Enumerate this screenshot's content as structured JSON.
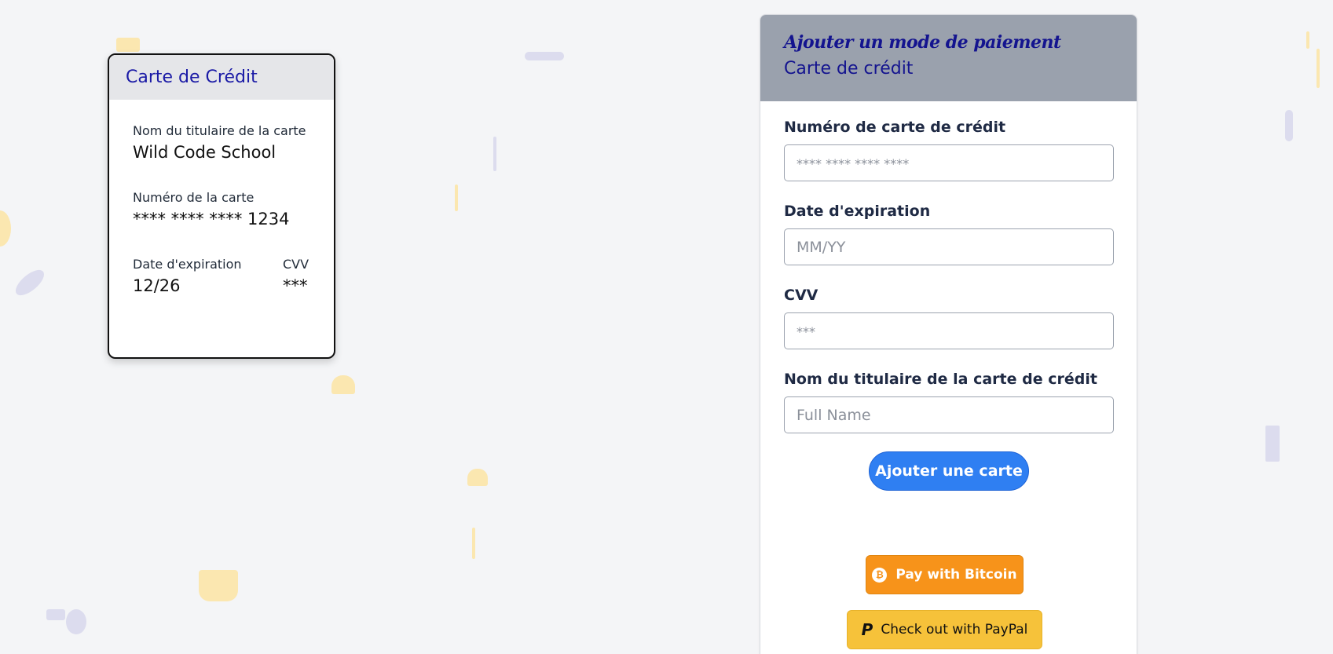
{
  "card_preview": {
    "title": "Carte de Crédit",
    "holder_label": "Nom du titulaire de la carte",
    "holder_value": "Wild Code School",
    "number_label": "Numéro de la carte",
    "number_value": "**** **** **** 1234",
    "expiry_label": "Date d'expiration",
    "expiry_value": "12/26",
    "cvv_label": "CVV",
    "cvv_value": "***"
  },
  "form": {
    "title": "Ajouter un mode de paiement",
    "subtitle": "Carte de crédit",
    "fields": {
      "card_number": {
        "label": "Numéro de carte de crédit",
        "placeholder": "**** **** **** ****"
      },
      "expiry": {
        "label": "Date d'expiration",
        "placeholder": "MM/YY"
      },
      "cvv": {
        "label": "CVV",
        "placeholder": "***"
      },
      "holder": {
        "label": "Nom du titulaire de la carte de crédit",
        "placeholder": "Full Name"
      }
    },
    "submit_label": "Ajouter une carte",
    "bitcoin_label": "Pay with Bitcoin",
    "bitcoin_icon_glyph": "₿",
    "paypal_label": "Check out with PayPal",
    "paypal_icon_glyph": "P"
  },
  "icons": {
    "bitcoin": "bitcoin-icon",
    "paypal": "paypal-icon"
  },
  "colors": {
    "background": "#f4f5f7",
    "accent_navy": "#14148f",
    "submit_blue": "#2f7ff2",
    "bitcoin_orange": "#f7931a",
    "paypal_yellow": "#f6c23a",
    "panel_header": "#9aa1ad"
  }
}
